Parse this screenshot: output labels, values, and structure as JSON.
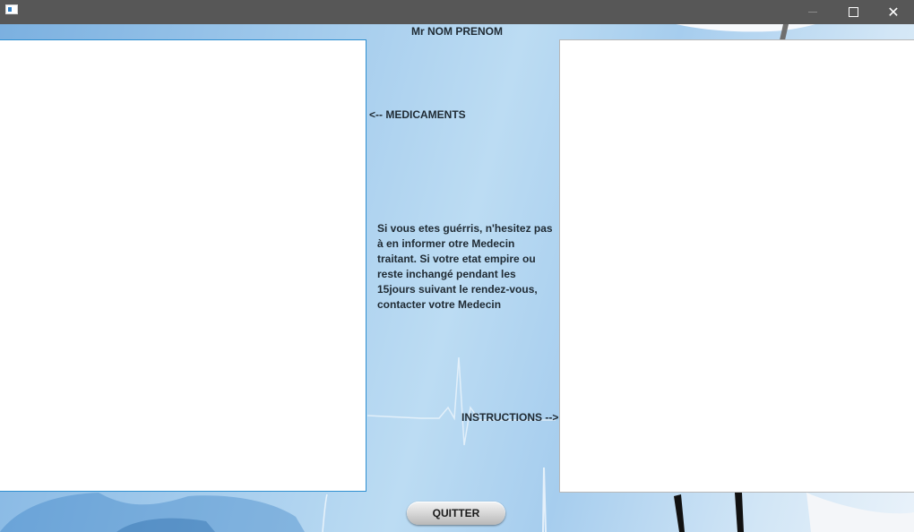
{
  "window": {
    "title": "",
    "controls": {
      "minimize_icon": "minimize-icon",
      "maximize_icon": "maximize-icon",
      "close_icon": "close-icon",
      "close_glyph": "✕"
    }
  },
  "header": {
    "patient_name": "Mr NOM PRENOM"
  },
  "medications": {
    "label": "<-- MEDICAMENTS"
  },
  "instructions": {
    "label": "INSTRUCTIONS -->"
  },
  "info": {
    "message": "Si vous etes guérris, n'hesitez pas à en informer otre Medecin traitant. Si votre etat empire ou reste inchangé pendant les 15jours suivant le rendez-vous, contacter votre Medecin"
  },
  "actions": {
    "quit_label": "QUITTER"
  },
  "colors": {
    "accent": "#2f8fd0",
    "background": "#a9cfee",
    "titlebar": "#575757"
  }
}
